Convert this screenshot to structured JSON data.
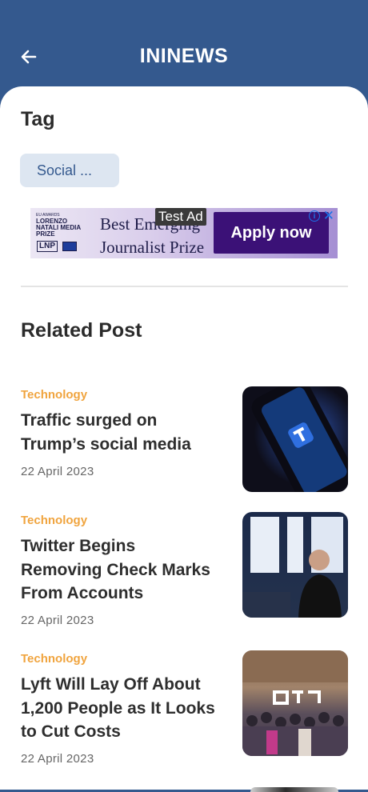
{
  "header": {
    "title": "ININEWS"
  },
  "tag_section": {
    "title": "Tag",
    "chip_label": "Social ..."
  },
  "ad": {
    "badge": "Test Ad",
    "logo_line1": "LORENZO",
    "logo_line2": "NATALI MEDIA",
    "logo_line3": "PRIZE",
    "logo_small": "EU AWARDS",
    "logo_lnp": "LNP",
    "headline_line1": "Best Emerging",
    "headline_line2": "Journalist Prize",
    "cta": "Apply now",
    "info_icon": "info-icon",
    "close_icon": "close-icon"
  },
  "related": {
    "title": "Related Post",
    "posts": [
      {
        "category": "Technology",
        "title": "Traffic surged on Trump’s social media",
        "date": "22 April 2023",
        "thumbnail": "phone-app-image"
      },
      {
        "category": "Technology",
        "title": "Twitter Begins Removing Check Marks From Accounts",
        "date": "22 April 2023",
        "thumbnail": "speaker-on-stage-image"
      },
      {
        "category": "Technology",
        "title": "Lyft Will Lay Off About 1,200 People as It Looks to Cut Costs",
        "date": "22 April 2023",
        "thumbnail": "office-crowd-image"
      }
    ]
  },
  "colors": {
    "header_bg": "#34598e",
    "accent_category": "#f0a43e",
    "chip_bg": "#dde6f1"
  }
}
